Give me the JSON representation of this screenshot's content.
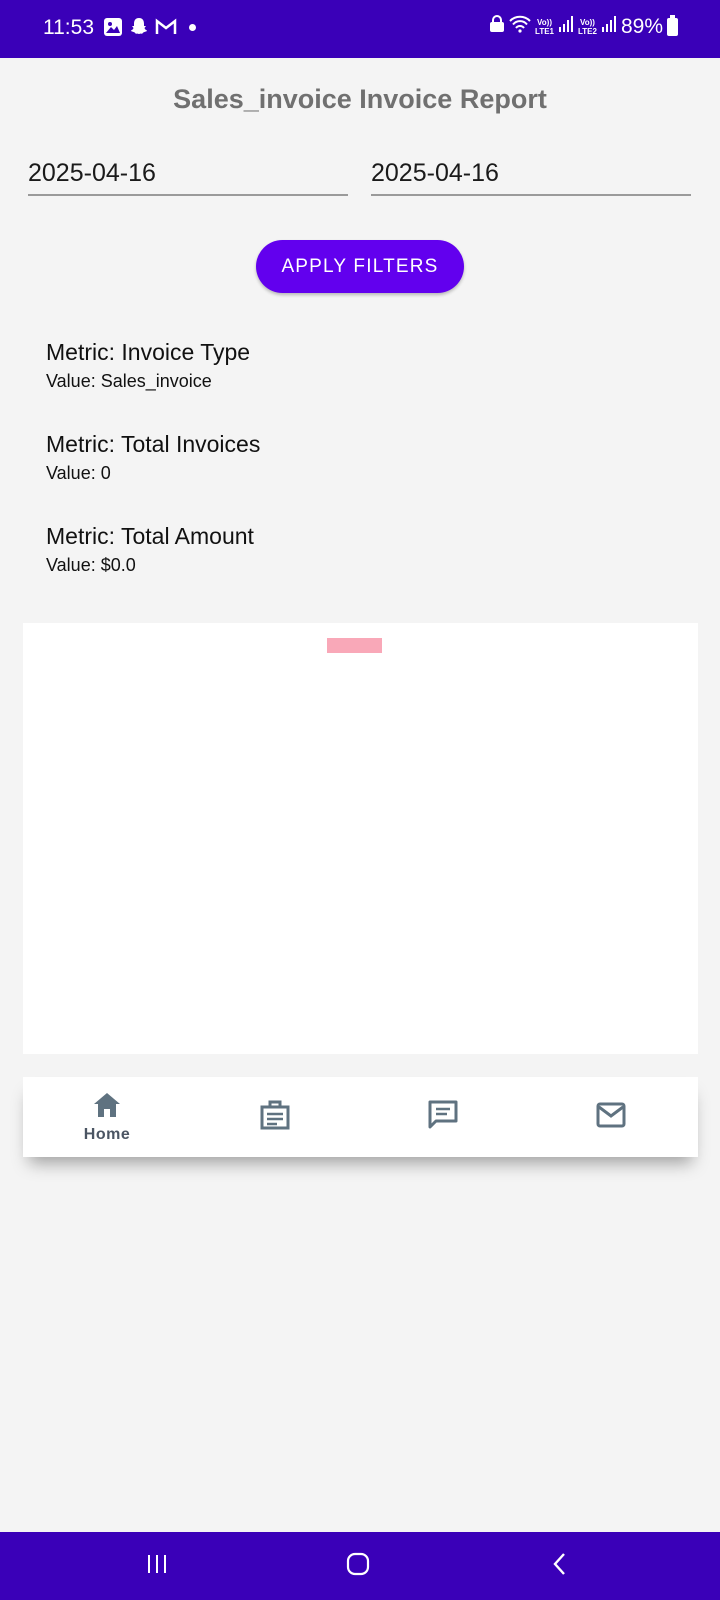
{
  "status_bar": {
    "time": "11:53",
    "battery": "89%",
    "sim1": "Vo))\nLTE1",
    "sim2": "Vo))\nLTE2",
    "icons": [
      "gallery-icon",
      "snapchat-icon",
      "gmail-icon",
      "dot-icon",
      "lock-icon",
      "wifi-icon",
      "signal-icon",
      "signal-icon",
      "battery-icon"
    ]
  },
  "page": {
    "title": "Sales_invoice Invoice Report"
  },
  "filters": {
    "start_date": "2025-04-16",
    "end_date": "2025-04-16",
    "apply_label": "APPLY FILTERS"
  },
  "metrics": [
    {
      "label": "Metric: Invoice Type",
      "value": "Value: Sales_invoice"
    },
    {
      "label": "Metric: Total Invoices",
      "value": "Value: 0"
    },
    {
      "label": "Metric: Total Amount",
      "value": "Value: $0.0"
    }
  ],
  "bottom_nav": {
    "items": [
      {
        "label": "Home",
        "icon": "home-icon",
        "active": true
      },
      {
        "label": "",
        "icon": "briefcase-icon",
        "active": false
      },
      {
        "label": "",
        "icon": "message-icon",
        "active": false
      },
      {
        "label": "",
        "icon": "mail-icon",
        "active": false
      }
    ]
  },
  "system_nav": {
    "icons": [
      "recent-apps-icon",
      "home-circle-icon",
      "back-icon"
    ]
  },
  "colors": {
    "status_bar": "#3a00b8",
    "accent": "#6200ee",
    "chart_legend": "#f9a8b8",
    "nav_icon": "#5f7280"
  }
}
